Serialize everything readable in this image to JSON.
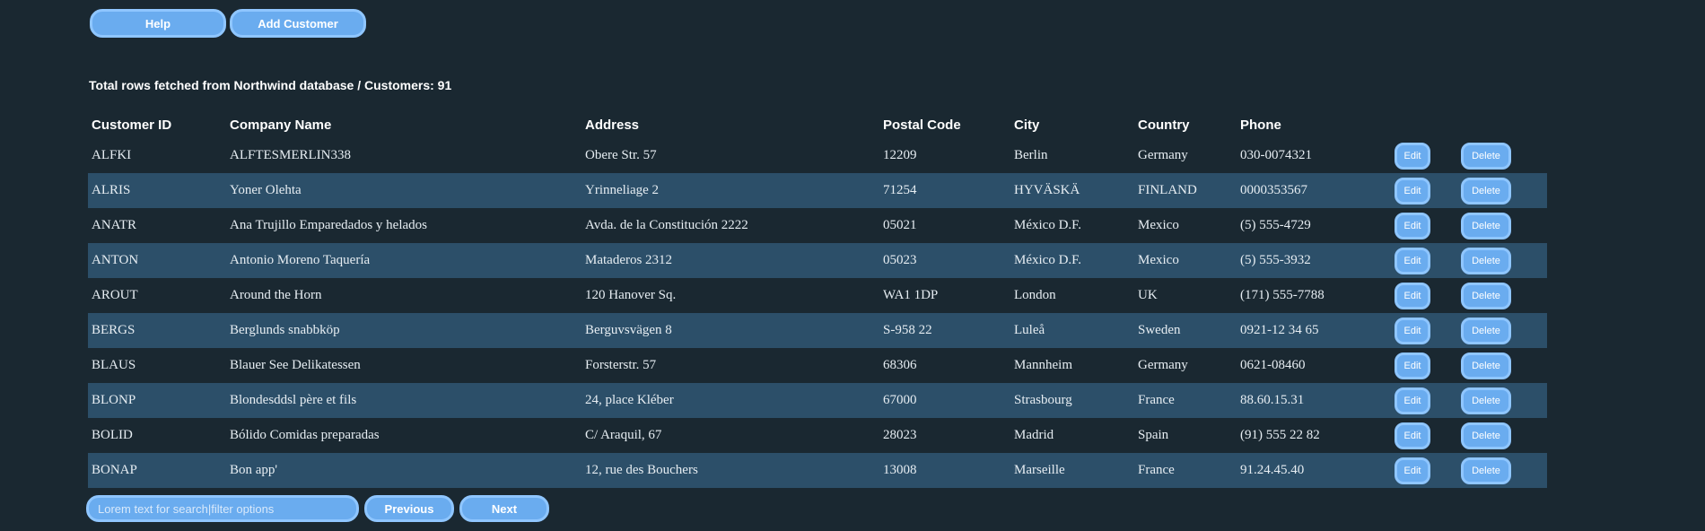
{
  "toolbar": {
    "help_label": "Help",
    "add_label": "Add Customer"
  },
  "info": {
    "text": "Total rows fetched from Northwind database / Customers: 91"
  },
  "table": {
    "columns": [
      "Customer ID",
      "Company Name",
      "Address",
      "Postal Code",
      "City",
      "Country",
      "Phone"
    ],
    "edit_label": "Edit",
    "delete_label": "Delete",
    "rows": [
      [
        "ALFKI",
        "ALFTESMERLIN338",
        "Obere Str. 57",
        "12209",
        "Berlin",
        "Germany",
        "030-0074321"
      ],
      [
        "ALRIS",
        "Yoner Olehta",
        "Yrinneliage 2",
        "71254",
        "HYVÄSKÄ",
        "FINLAND",
        "0000353567"
      ],
      [
        "ANATR",
        "Ana Trujillo Emparedados y helados",
        "Avda. de la Constitución 2222",
        "05021",
        "México D.F.",
        "Mexico",
        "(5) 555-4729"
      ],
      [
        "ANTON",
        "Antonio Moreno Taquería",
        "Mataderos 2312",
        "05023",
        "México D.F.",
        "Mexico",
        "(5) 555-3932"
      ],
      [
        "AROUT",
        "Around the Horn",
        "120 Hanover Sq.",
        "WA1 1DP",
        "London",
        "UK",
        "(171) 555-7788"
      ],
      [
        "BERGS",
        "Berglunds snabbköp",
        "Berguvsvägen 8",
        "S-958 22",
        "Luleå",
        "Sweden",
        "0921-12 34 65"
      ],
      [
        "BLAUS",
        "Blauer See Delikatessen",
        "Forsterstr. 57",
        "68306",
        "Mannheim",
        "Germany",
        "0621-08460"
      ],
      [
        "BLONP",
        "Blondesddsl père et fils",
        "24, place Kléber",
        "67000",
        "Strasbourg",
        "France",
        "88.60.15.31"
      ],
      [
        "BOLID",
        "Bólido Comidas preparadas",
        "C/ Araquil, 67",
        "28023",
        "Madrid",
        "Spain",
        "(91) 555 22 82"
      ],
      [
        "BONAP",
        "Bon app'",
        "12, rue des Bouchers",
        "13008",
        "Marseille",
        "France",
        "91.24.45.40"
      ]
    ]
  },
  "pagination": {
    "search_placeholder": "Lorem text for search|filter options",
    "prev_label": "Previous",
    "next_label": "Next"
  },
  "colors": {
    "background": "#1a2831",
    "row_stripe": "#2c4f69",
    "button": "#6aacef"
  }
}
